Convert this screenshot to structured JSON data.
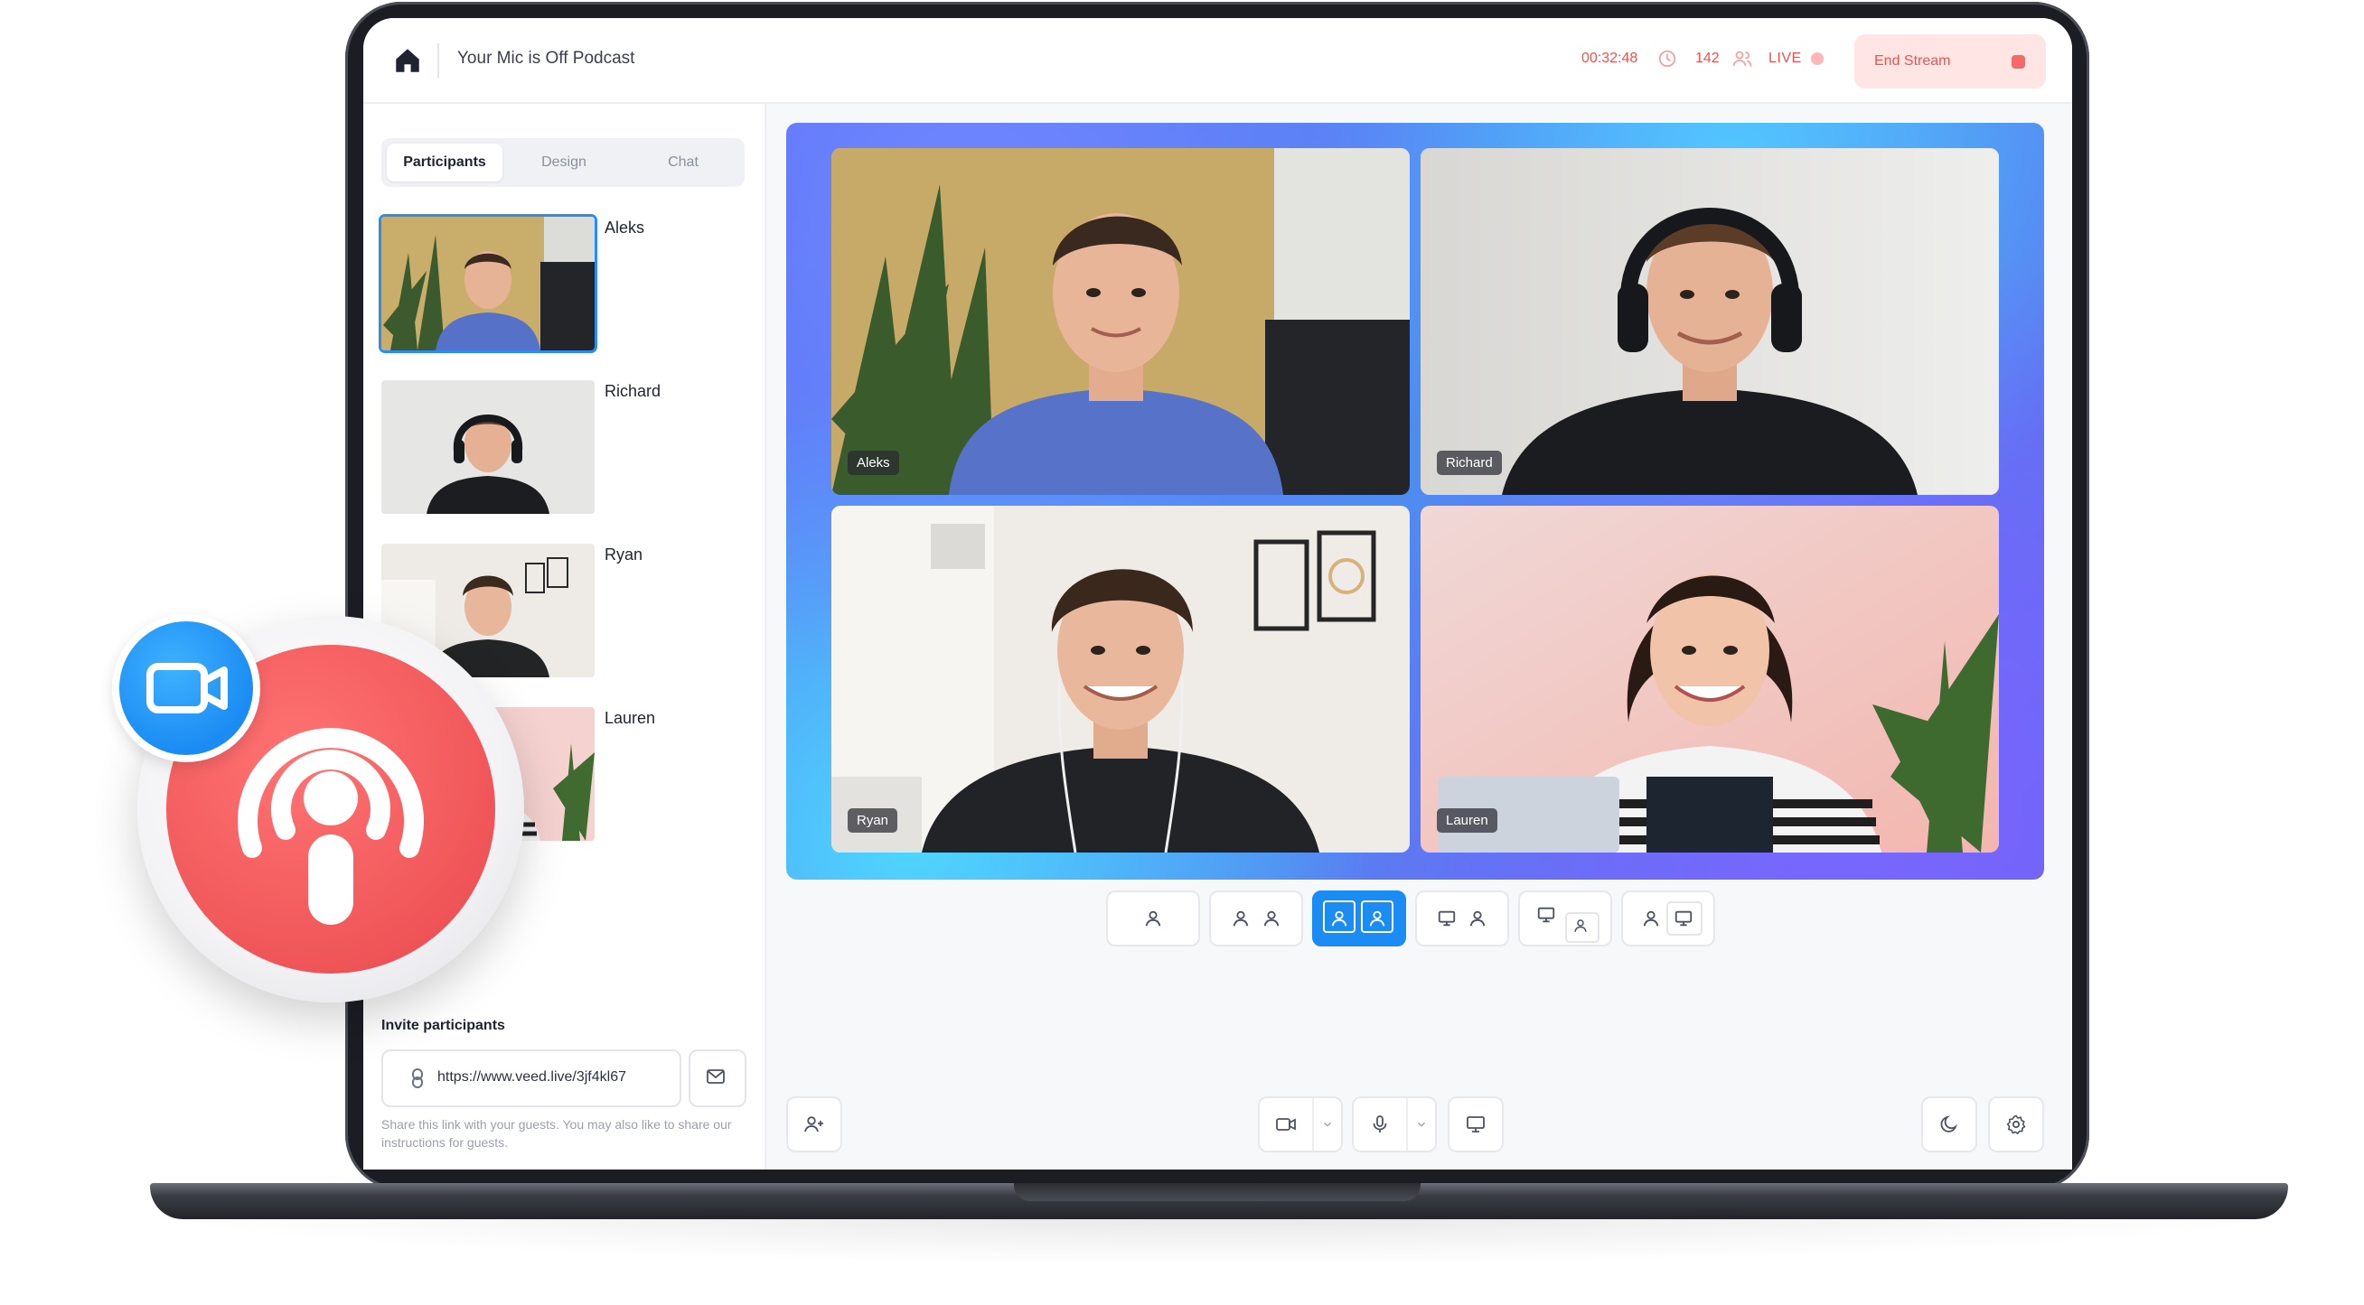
{
  "app": {
    "title": "Your Mic is Off Podcast",
    "timer": "00:32:48",
    "viewer_count": "142",
    "live_label": "LIVE",
    "end_stream_label": "End Stream"
  },
  "sidebar": {
    "tabs": [
      {
        "label": "Participants",
        "active": true
      },
      {
        "label": "Design",
        "active": false
      },
      {
        "label": "Chat",
        "active": false
      }
    ],
    "participants": [
      {
        "name": "Aleks",
        "selected": true
      },
      {
        "name": "Richard",
        "selected": false
      },
      {
        "name": "Ryan",
        "selected": false
      },
      {
        "name": "Lauren",
        "selected": false
      }
    ],
    "invite": {
      "title": "Invite participants",
      "link": "https://www.veed.live/3jf4kl67",
      "help": "Share this link with your guests. You may also like to share our instructions for guests."
    }
  },
  "stage": {
    "tiles": [
      {
        "name": "Aleks"
      },
      {
        "name": "Richard"
      },
      {
        "name": "Ryan"
      },
      {
        "name": "Lauren"
      }
    ]
  },
  "layouts": {
    "active_index": 2,
    "options": [
      "single-person",
      "two-person-side",
      "two-person-grid",
      "screen-and-person",
      "screen-with-person-pip",
      "person-and-screen"
    ]
  },
  "toolbar": {
    "icons": [
      "add-person-icon",
      "camera-icon",
      "microphone-icon",
      "screen-share-icon",
      "moon-icon",
      "gear-icon"
    ]
  },
  "colors": {
    "accent": "#1b8cf3",
    "live_red": "#f0524f",
    "end_stream_bg": "#ffe5e4",
    "badge_red": "#f25a5c"
  }
}
